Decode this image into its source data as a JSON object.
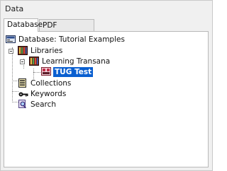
{
  "panel": {
    "title": "Data"
  },
  "tabs": [
    {
      "label": "Database",
      "active": true
    },
    {
      "label": "PDF Selections",
      "active": false
    }
  ],
  "tree": {
    "root": {
      "label": "Database: Tutorial Examples",
      "icon": "database-icon"
    },
    "items": [
      {
        "label": "Libraries",
        "icon": "library-icon",
        "expanded": true
      },
      {
        "label": "Learning Transana",
        "icon": "library-icon",
        "expanded": true
      },
      {
        "label": "TUG Test",
        "icon": "document-icon",
        "selected": true
      },
      {
        "label": "Collections",
        "icon": "collections-icon"
      },
      {
        "label": "Keywords",
        "icon": "keywords-icon"
      },
      {
        "label": "Search",
        "icon": "search-icon"
      }
    ]
  },
  "colors": {
    "selection": "#0a5fd0",
    "panel_bg": "#f0f0f0"
  }
}
